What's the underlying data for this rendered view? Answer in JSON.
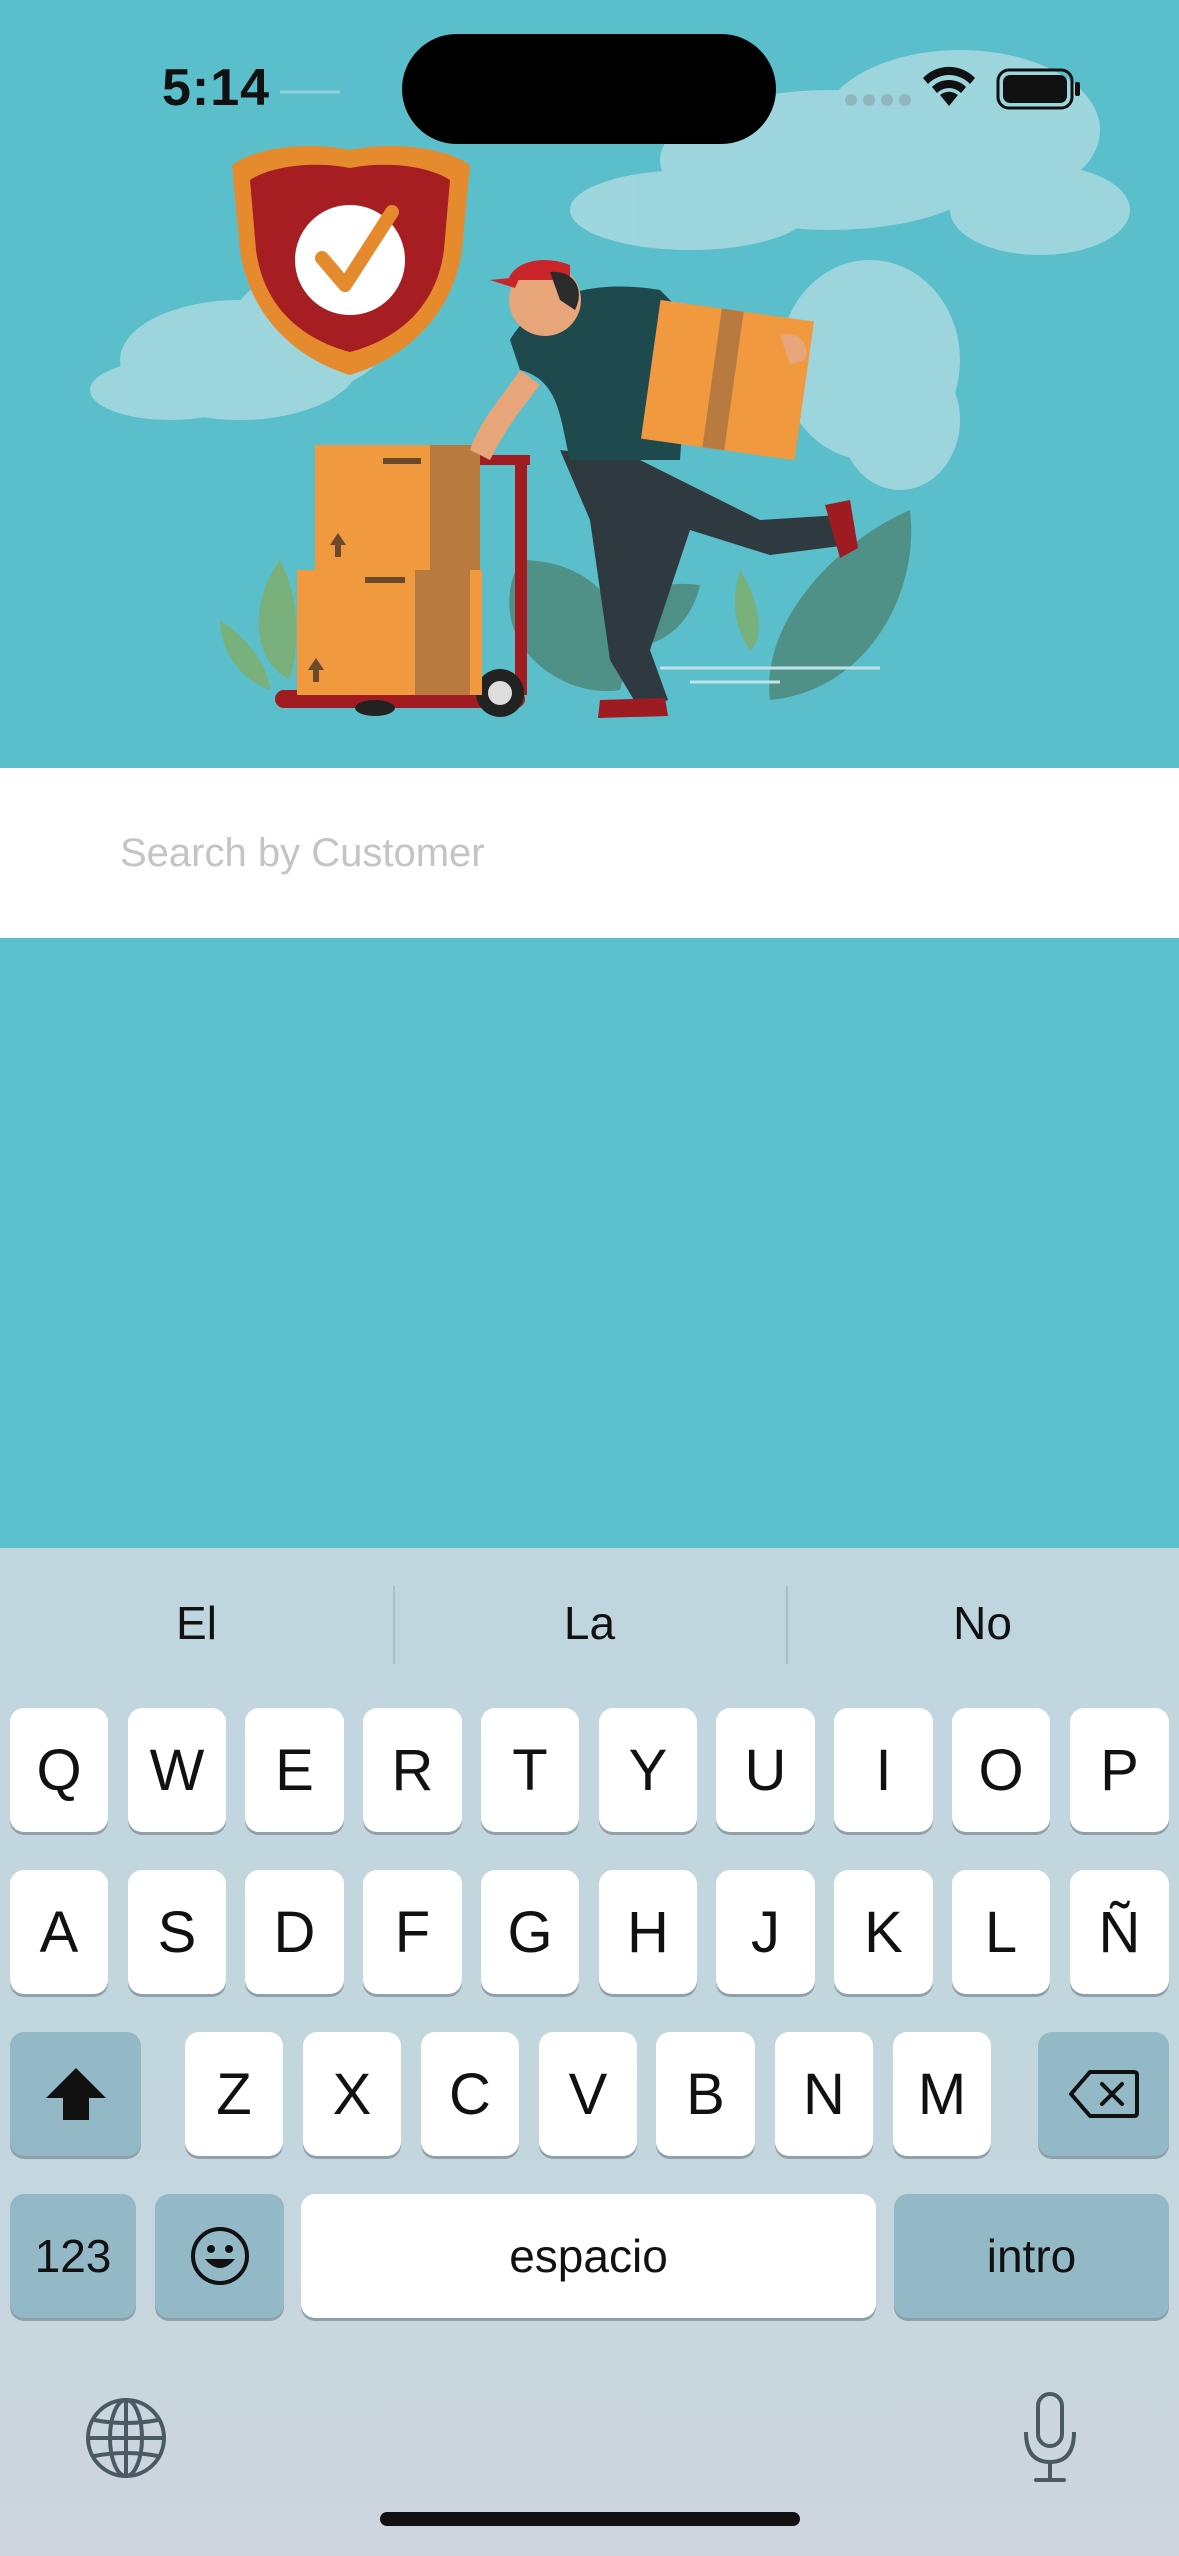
{
  "status_bar": {
    "time": "5:14"
  },
  "search": {
    "placeholder": "Search by Customer",
    "value": ""
  },
  "keyboard": {
    "suggestions": [
      "El",
      "La",
      "No"
    ],
    "row1": [
      "Q",
      "W",
      "E",
      "R",
      "T",
      "Y",
      "U",
      "I",
      "O",
      "P"
    ],
    "row2": [
      "A",
      "S",
      "D",
      "F",
      "G",
      "H",
      "J",
      "K",
      "L",
      "Ñ"
    ],
    "row3": [
      "Z",
      "X",
      "C",
      "V",
      "B",
      "N",
      "M"
    ],
    "numbers_label": "123",
    "space_label": "espacio",
    "return_label": "intro"
  },
  "colors": {
    "background": "#5bc0cb",
    "search_bar": "#ffffff",
    "placeholder": "#c4c4c7",
    "keyboard_bg": "#c3d6de",
    "special_key": "#93b8c6"
  }
}
